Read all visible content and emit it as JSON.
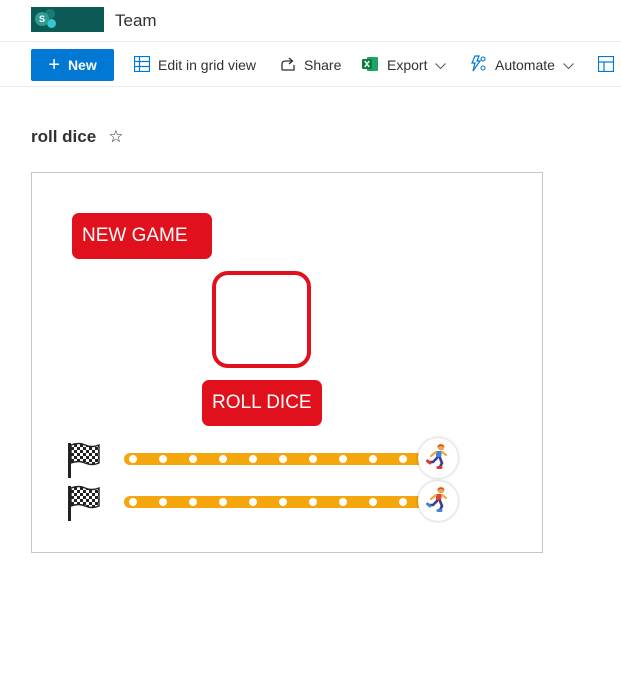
{
  "header": {
    "logo_letter": "S",
    "site_title": "Team"
  },
  "commandbar": {
    "new_label": "New",
    "edit_grid_label": "Edit in grid view",
    "share_label": "Share",
    "export_label": "Export",
    "automate_label": "Automate"
  },
  "page": {
    "title": "roll dice",
    "favorite_glyph": "☆"
  },
  "game": {
    "new_game_label": "NEW GAME",
    "roll_dice_label": "ROLL DICE",
    "dice_value": "",
    "tracks": [
      {
        "finish_icon": "checkered-flag-icon",
        "spaces": 10,
        "player_icon": "runner-icon"
      },
      {
        "finish_icon": "checkered-flag-icon",
        "spaces": 10,
        "player_icon": "runner-icon"
      }
    ]
  },
  "colors": {
    "accent_blue": "#0078d4",
    "game_red": "#e1101d",
    "track_orange": "#f5a60c",
    "logo_teal": "#0b5a55"
  }
}
